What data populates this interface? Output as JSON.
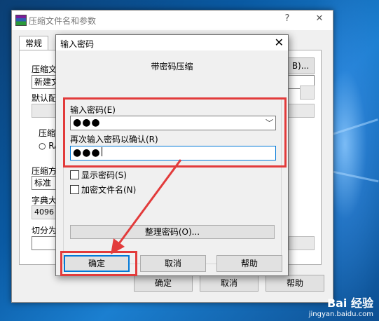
{
  "main_window": {
    "title": "压缩文件名和参数",
    "help_button": "?",
    "close_button": "✕",
    "tab_general": "常规",
    "label_archive_name": "压缩文",
    "archive_name_value": "新建文",
    "browse_button": "B)...",
    "label_default_profile": "默认配",
    "label_format": "压缩",
    "format_radio": "RA",
    "label_method": "压缩方",
    "method_value": "标准",
    "label_dictionary": "字典大",
    "dictionary_value": "4096",
    "label_split": "切分为",
    "ok_button": "确定",
    "cancel_button": "取消",
    "help_button_bottom": "帮助"
  },
  "password_dialog": {
    "title": "输入密码",
    "close_button": "✕",
    "heading": "带密码压缩",
    "enter_password_label": "输入密码(E)",
    "password_value": "●●●",
    "reenter_password_label": "再次输入密码以确认(R)",
    "reenter_value": "●●●",
    "show_password_label": "显示密码(S)",
    "encrypt_filenames_label": "加密文件名(N)",
    "organize_passwords_button": "整理密码(O)...",
    "ok_button": "确定",
    "cancel_button": "取消",
    "help_button": "帮助"
  },
  "watermark": {
    "brand": "Bai 经验",
    "url": "jingyan.baidu.com"
  },
  "colors": {
    "highlight_red": "#e23b3b",
    "focus_blue": "#0078d7"
  }
}
